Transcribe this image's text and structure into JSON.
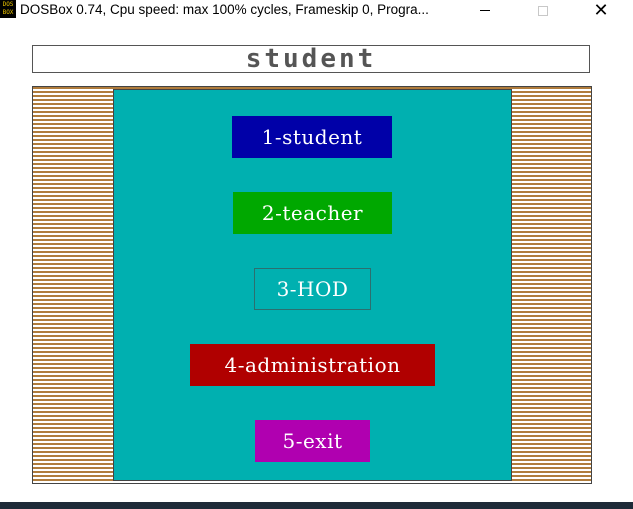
{
  "window": {
    "title": "DOSBox 0.74, Cpu speed: max 100% cycles, Frameskip  0, Progra...",
    "icon_text": "DOS BOX",
    "icons": {
      "app": "dosbox-icon",
      "minimize": "minimize-icon",
      "maximize": "maximize-icon",
      "close": "close-icon"
    },
    "close_glyph": "✕"
  },
  "screen": {
    "header": "student",
    "menu": [
      {
        "label": "1-student",
        "color": "#0000a8"
      },
      {
        "label": "2-teacher",
        "color": "#00a800"
      },
      {
        "label": "3-HOD",
        "color": "#00b0b0"
      },
      {
        "label": "4-administration",
        "color": "#b00000"
      },
      {
        "label": "5-exit",
        "color": "#b000b0"
      }
    ],
    "colors": {
      "panel": "#00b0b0",
      "border_stripe": "#b07c3c"
    }
  }
}
